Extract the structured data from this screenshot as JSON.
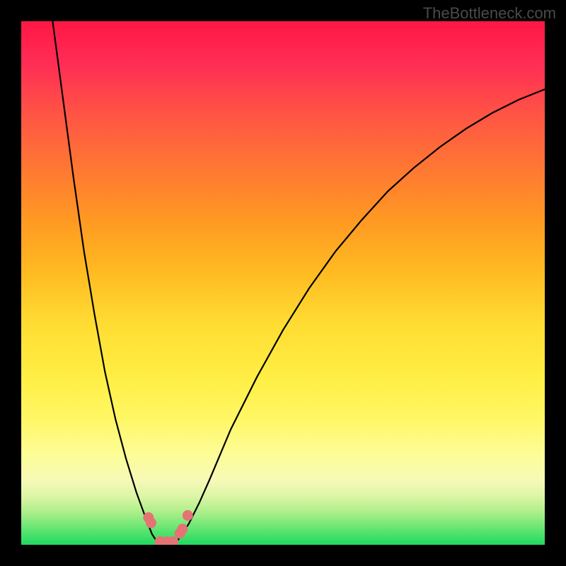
{
  "watermark": "TheBottleneck.com",
  "chart_data": {
    "type": "line",
    "title": "",
    "xlabel": "",
    "ylabel": "",
    "xlim": [
      0,
      100
    ],
    "ylim": [
      0,
      100
    ],
    "background_gradient": [
      "#ff1744",
      "#ffdd33",
      "#1fd95f"
    ],
    "series": [
      {
        "name": "left-curve",
        "x": [
          6,
          8,
          10,
          12,
          14,
          16,
          18,
          20,
          22,
          24,
          25,
          26,
          27,
          28
        ],
        "y": [
          100,
          85,
          70,
          56,
          44,
          33,
          24,
          16.5,
          10,
          4.5,
          2,
          0.5,
          0,
          0
        ]
      },
      {
        "name": "right-curve",
        "x": [
          28,
          30,
          32,
          34,
          36,
          40,
          45,
          50,
          55,
          60,
          65,
          70,
          75,
          80,
          85,
          90,
          95,
          100
        ],
        "y": [
          0,
          1,
          4,
          8,
          12.5,
          22,
          32,
          41,
          49,
          56,
          62,
          67.5,
          72,
          76,
          79.5,
          82.5,
          85,
          87
        ]
      }
    ],
    "markers": [
      {
        "x": 24.3,
        "y": 5.2
      },
      {
        "x": 24.8,
        "y": 4.2
      },
      {
        "x": 26.5,
        "y": 0.6
      },
      {
        "x": 27.8,
        "y": 0.6
      },
      {
        "x": 29.0,
        "y": 0.6
      },
      {
        "x": 30.3,
        "y": 2.2
      },
      {
        "x": 30.8,
        "y": 3.0
      },
      {
        "x": 31.8,
        "y": 5.6
      }
    ],
    "marker_color": "#e57373"
  }
}
